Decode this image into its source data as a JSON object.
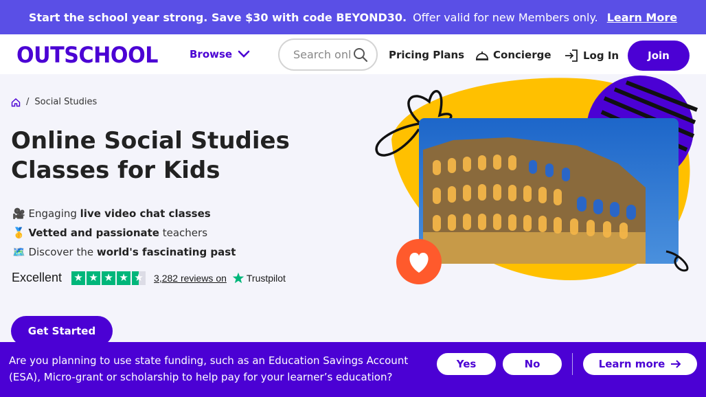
{
  "promo": {
    "headline": "Start the school year strong. Save $30 with code BEYOND30.",
    "offer": "Offer valid for new Members only.",
    "link": "Learn More"
  },
  "header": {
    "logo": "OUTSCHOOL",
    "browse": "Browse",
    "search_placeholder": "Search online classes",
    "pricing": "Pricing Plans",
    "concierge": "Concierge",
    "login": "Log In",
    "join": "Join"
  },
  "breadcrumb": {
    "current": "Social Studies"
  },
  "main": {
    "title": "Online Social Studies Classes for Kids",
    "features": [
      {
        "emoji": "🎥",
        "pre": "Engaging ",
        "bold": "live video chat classes",
        "post": ""
      },
      {
        "emoji": "🥇",
        "pre": "",
        "bold": "Vetted and passionate",
        "post": " teachers"
      },
      {
        "emoji": "🗺️",
        "pre": "Discover the ",
        "bold": "world's fascinating past",
        "post": ""
      }
    ],
    "trustpilot": {
      "rating_text": "Excellent",
      "stars": 4.5,
      "reviews": "3,282 reviews on",
      "brand": "Trustpilot"
    },
    "cta": "Get Started"
  },
  "banner": {
    "question": "Are you planning to use state funding, such as an Education Savings Account (ESA), Micro-grant or scholarship to help pay for your learner’s education?",
    "yes": "Yes",
    "no": "No",
    "learn_more": "Learn more"
  },
  "colors": {
    "brand": "#4b01d4",
    "promo_bg": "#5a4fe6",
    "accent_yellow": "#ffc000",
    "heart": "#ff5a2c",
    "trustpilot": "#00b67a"
  },
  "icons": [
    "home-icon",
    "chevron-down-icon",
    "search-icon",
    "concierge-bell-icon",
    "login-icon",
    "heart-icon",
    "arrow-right-icon",
    "trustpilot-star-icon"
  ]
}
